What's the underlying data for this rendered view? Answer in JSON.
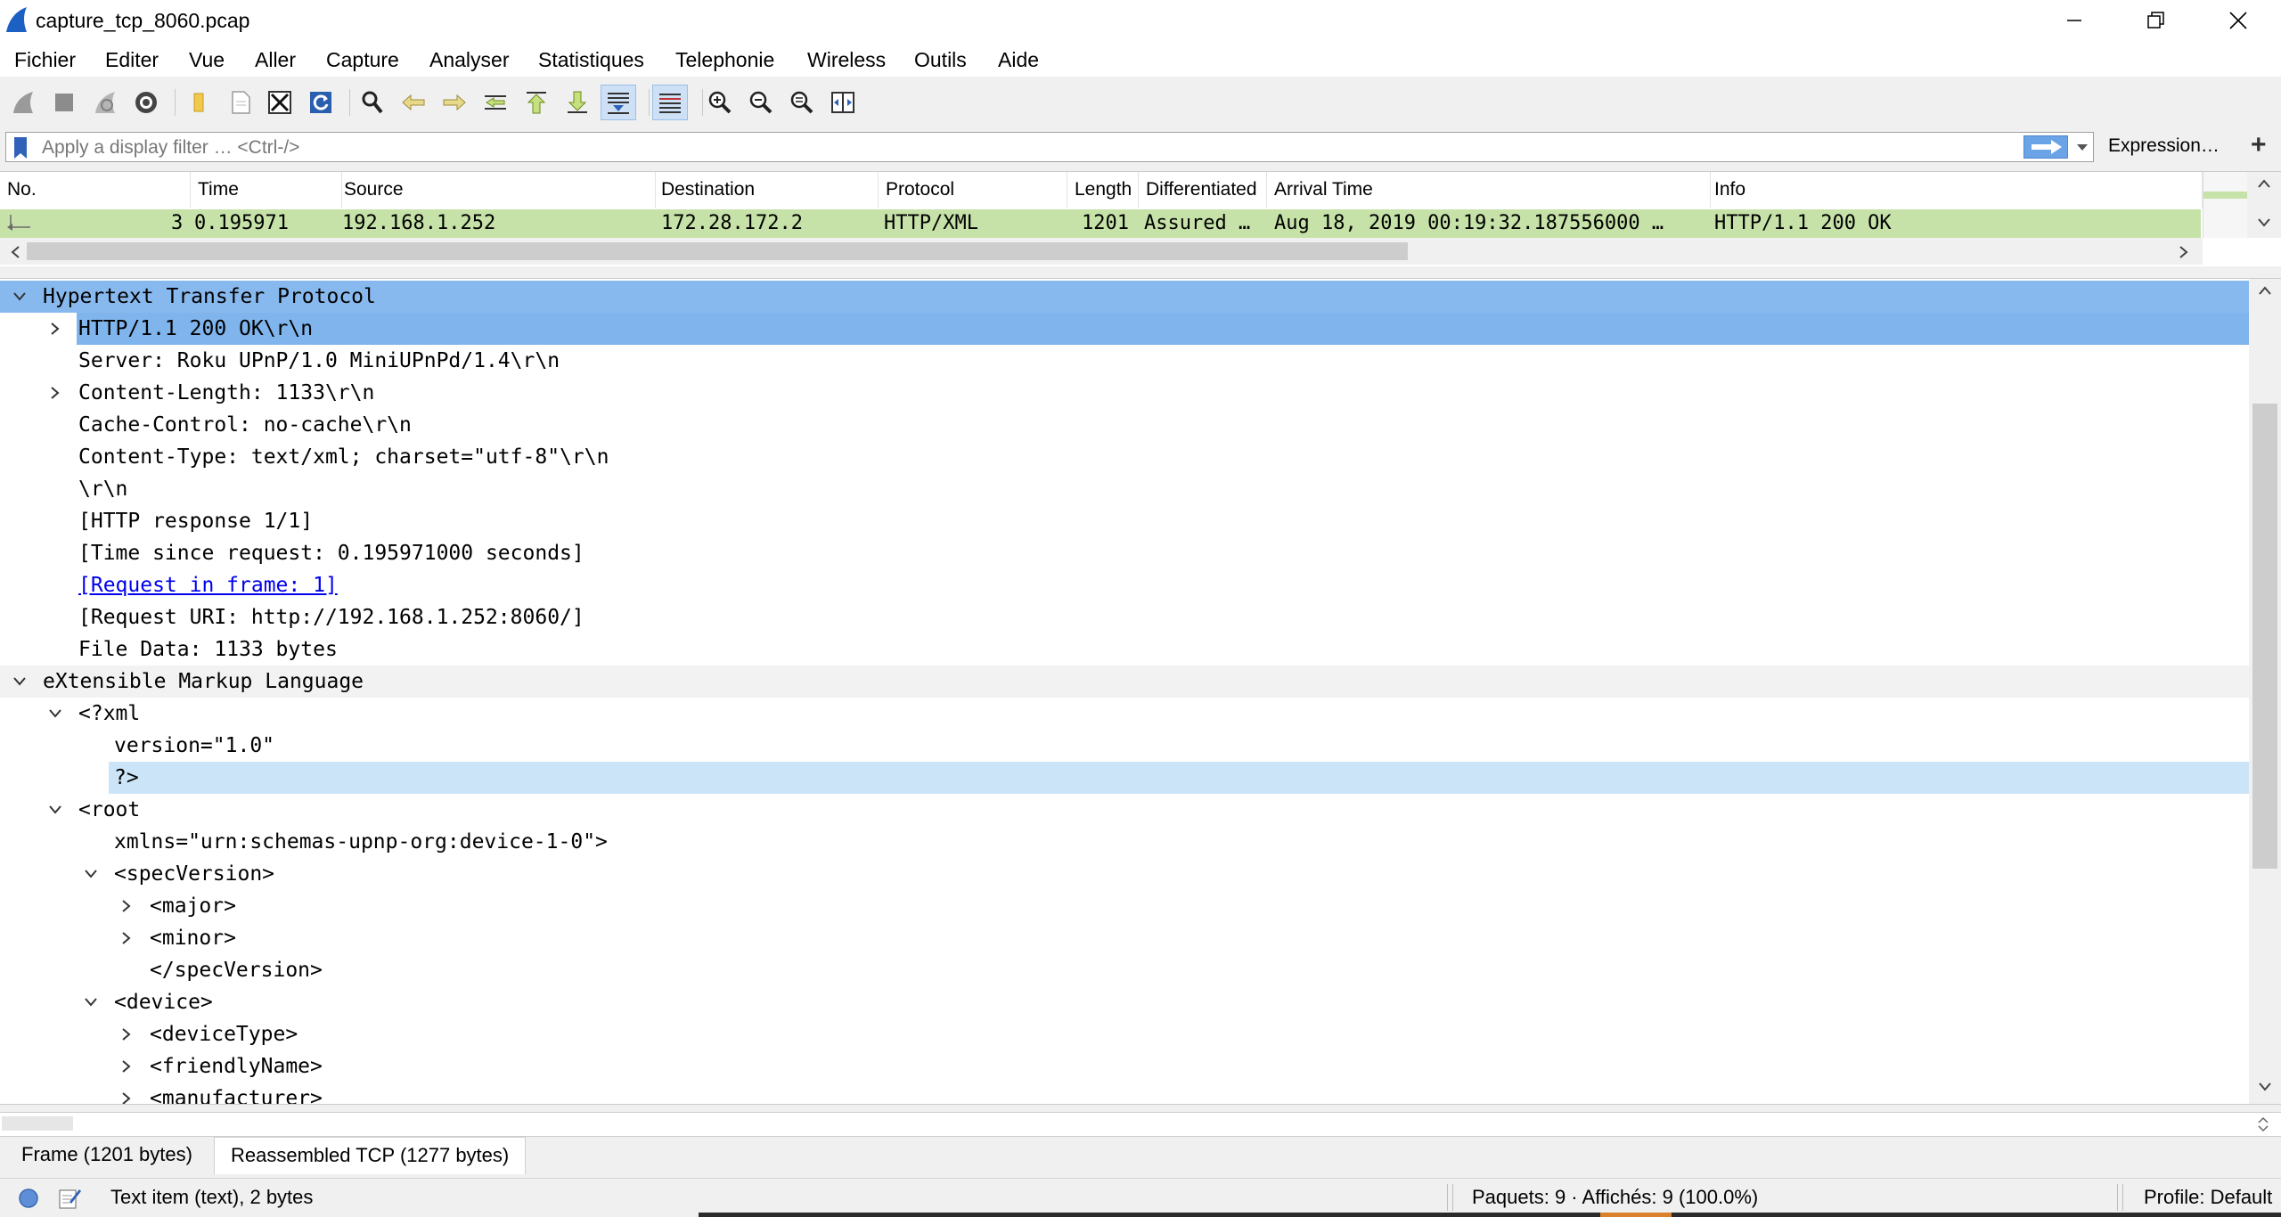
{
  "window": {
    "title": "capture_tcp_8060.pcap",
    "controls": [
      "minimize-icon",
      "restore-icon",
      "close-icon"
    ]
  },
  "menu": [
    "Fichier",
    "Editer",
    "Vue",
    "Aller",
    "Capture",
    "Analyser",
    "Statistiques",
    "Telephonie",
    "Wireless",
    "Outils",
    "Aide"
  ],
  "toolbar": {
    "icons": [
      "shark-fin-start-icon",
      "stop-icon",
      "restart-icon",
      "capture-options-icon",
      "open-folder-icon",
      "file-icon",
      "close-file-icon",
      "reload-icon",
      "find-icon",
      "go-back-icon",
      "go-forward-icon",
      "go-to-packet-icon",
      "first-packet-icon",
      "last-packet-icon",
      "autoscroll-icon",
      "colorize-icon",
      "zoom-in-icon",
      "zoom-out-icon",
      "zoom-normal-icon",
      "resize-columns-icon"
    ]
  },
  "filter": {
    "placeholder": "Apply a display filter … <Ctrl-/>",
    "value": "",
    "expression_label": "Expression…",
    "add_label": "+"
  },
  "packet_list": {
    "columns": [
      "No.",
      "Time",
      "Source",
      "Destination",
      "Protocol",
      "Length",
      "Differentiated",
      "Arrival Time",
      "Info"
    ],
    "rows": [
      {
        "no": "3",
        "time": "0.195971",
        "source": "192.168.1.252",
        "destination": "172.28.172.2",
        "protocol": "HTTP/XML",
        "length": "1201",
        "dscp": "Assured …",
        "arrival": "Aug 18, 2019 00:19:32.187556000 …",
        "info": "HTTP/1.1 200 OK"
      }
    ],
    "row_color": "#c6e2a8"
  },
  "details": [
    {
      "text": "Hypertext Transfer Protocol",
      "expander": "expanded",
      "style": "selected-parent"
    },
    {
      "text": "HTTP/1.1 200 OK\\r\\n",
      "expander": "collapsed",
      "style": "selected"
    },
    {
      "text": "Server: Roku UPnP/1.0 MiniUPnPd/1.4\\r\\n",
      "expander": "none",
      "style": "normal"
    },
    {
      "text": "Content-Length: 1133\\r\\n",
      "expander": "collapsed",
      "style": "normal"
    },
    {
      "text": "Cache-Control: no-cache\\r\\n",
      "expander": "none",
      "style": "normal"
    },
    {
      "text": "Content-Type: text/xml; charset=\"utf-8\"\\r\\n",
      "expander": "none",
      "style": "normal"
    },
    {
      "text": "\\r\\n",
      "expander": "none",
      "style": "normal"
    },
    {
      "text": "[HTTP response 1/1]",
      "expander": "none",
      "style": "normal"
    },
    {
      "text": "[Time since request: 0.195971000 seconds]",
      "expander": "none",
      "style": "normal"
    },
    {
      "text": "[Request in frame: 1]",
      "expander": "none",
      "style": "link"
    },
    {
      "text": "[Request URI: http://192.168.1.252:8060/]",
      "expander": "none",
      "style": "normal"
    },
    {
      "text": "File Data: 1133 bytes",
      "expander": "none",
      "style": "normal"
    },
    {
      "text": "eXtensible Markup Language",
      "expander": "expanded",
      "style": "group"
    },
    {
      "text": "<?xml",
      "expander": "expanded",
      "style": "normal"
    },
    {
      "text": "version=\"1.0\"",
      "expander": "none",
      "style": "normal"
    },
    {
      "text": "?>",
      "expander": "none",
      "style": "hover"
    },
    {
      "text": "<root",
      "expander": "expanded",
      "style": "normal"
    },
    {
      "text": "xmlns=\"urn:schemas-upnp-org:device-1-0\">",
      "expander": "none",
      "style": "normal"
    },
    {
      "text": "<specVersion>",
      "expander": "expanded",
      "style": "normal"
    },
    {
      "text": "<major>",
      "expander": "collapsed",
      "style": "normal"
    },
    {
      "text": "<minor>",
      "expander": "collapsed",
      "style": "normal"
    },
    {
      "text": "</specVersion>",
      "expander": "none",
      "style": "normal"
    },
    {
      "text": "<device>",
      "expander": "expanded",
      "style": "normal"
    },
    {
      "text": "<deviceType>",
      "expander": "collapsed",
      "style": "normal"
    },
    {
      "text": "<friendlyName>",
      "expander": "collapsed",
      "style": "normal"
    },
    {
      "text": "<manufacturer>",
      "expander": "collapsed",
      "style": "normal"
    }
  ],
  "bytes_tabs": [
    "Frame (1201 bytes)",
    "Reassembled TCP (1277 bytes)"
  ],
  "status": {
    "item": "Text item (text), 2 bytes",
    "packets": "Paquets: 9 · Affichés: 9 (100.0%)",
    "profile": "Profile: Default"
  },
  "colors": {
    "selected": "#7fb4ec",
    "selected_parent": "#88b9ee",
    "hover": "#cce4f7",
    "group_bg": "#f2f2f2",
    "link": "#0000ee",
    "packet_row": "#c6e2a8"
  }
}
